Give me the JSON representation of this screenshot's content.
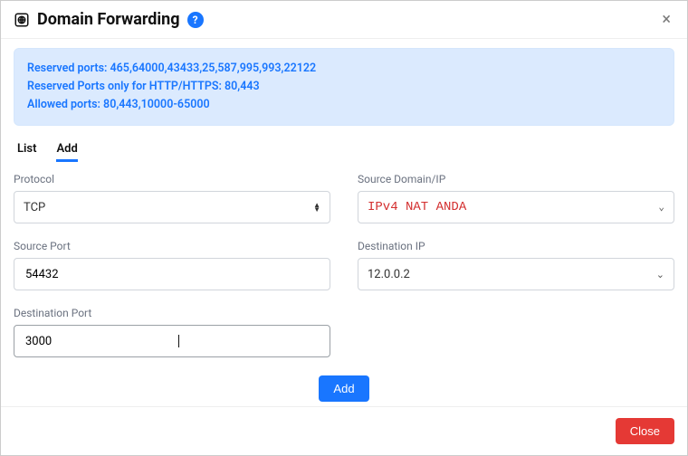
{
  "header": {
    "title": "Domain Forwarding",
    "help_glyph": "?"
  },
  "info": {
    "line1": "Reserved ports: 465,64000,43433,25,587,995,993,22122",
    "line2": "Reserved Ports only for HTTP/HTTPS: 80,443",
    "line3": "Allowed ports: 80,443,10000-65000"
  },
  "tabs": {
    "list": "List",
    "add": "Add"
  },
  "form": {
    "protocol_label": "Protocol",
    "protocol_value": "TCP",
    "source_domain_label": "Source Domain/IP",
    "source_domain_value": "IPv4 NAT ANDA",
    "source_port_label": "Source Port",
    "source_port_value": "54432",
    "dest_ip_label": "Destination IP",
    "dest_ip_value": "12.0.0.2",
    "dest_port_label": "Destination Port",
    "dest_port_value": "3000"
  },
  "buttons": {
    "add": "Add",
    "close": "Close"
  }
}
